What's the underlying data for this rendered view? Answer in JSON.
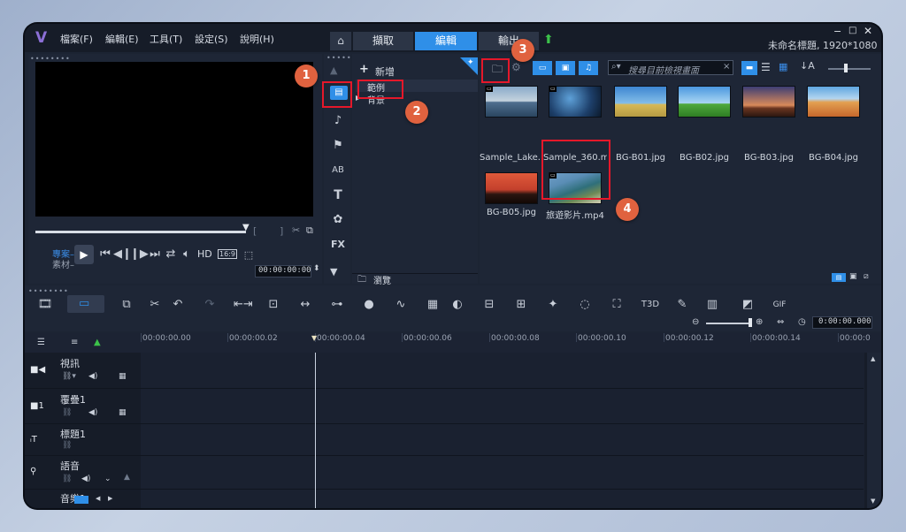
{
  "menu": {
    "file": "檔案(F)",
    "edit": "編輯(E)",
    "tools": "工具(T)",
    "settings": "設定(S)",
    "help": "說明(H)"
  },
  "steps": {
    "capture": "擷取",
    "edit": "編輯",
    "share": "輸出"
  },
  "window": {
    "title": "未命名標題, 1920*1080"
  },
  "library": {
    "add_label": "新增",
    "folders": [
      "範例",
      "背景"
    ],
    "browse_label": "瀏覽",
    "search_placeholder": "搜尋目前檢視畫面",
    "items": [
      {
        "label": "Sample_Lake....",
        "type": "video"
      },
      {
        "label": "Sample_360.m...",
        "type": "video"
      },
      {
        "label": "BG-B01.jpg",
        "type": "image"
      },
      {
        "label": "BG-B02.jpg",
        "type": "image"
      },
      {
        "label": "BG-B03.jpg",
        "type": "image"
      },
      {
        "label": "BG-B04.jpg",
        "type": "image"
      },
      {
        "label": "BG-B05.jpg",
        "type": "image"
      },
      {
        "label": "旅遊影片.mp4",
        "type": "video"
      }
    ]
  },
  "player": {
    "project_label": "專案–",
    "clip_label": "素材–",
    "hd_label": "HD",
    "ratio_label": "16:9",
    "timecode": "00:00:00:00"
  },
  "timeline": {
    "timecode": "0:00:00.000",
    "ruler": [
      "00:00:00.00",
      "00:00:00.02",
      "00:00:00.04",
      "00:00:00.06",
      "00:00:00.08",
      "00:00:00.10",
      "00:00:00.12",
      "00:00:00.14",
      "00:00:0"
    ],
    "tracks": [
      {
        "name": "視訊"
      },
      {
        "name": "覆疊1"
      },
      {
        "name": "標題1"
      },
      {
        "name": "語音"
      },
      {
        "name": "音樂1"
      }
    ]
  },
  "annotations": [
    "1",
    "2",
    "3",
    "4"
  ],
  "colors": {
    "accent": "#2f8fe8",
    "highlight": "#e5182a",
    "badge": "#e0623f"
  }
}
